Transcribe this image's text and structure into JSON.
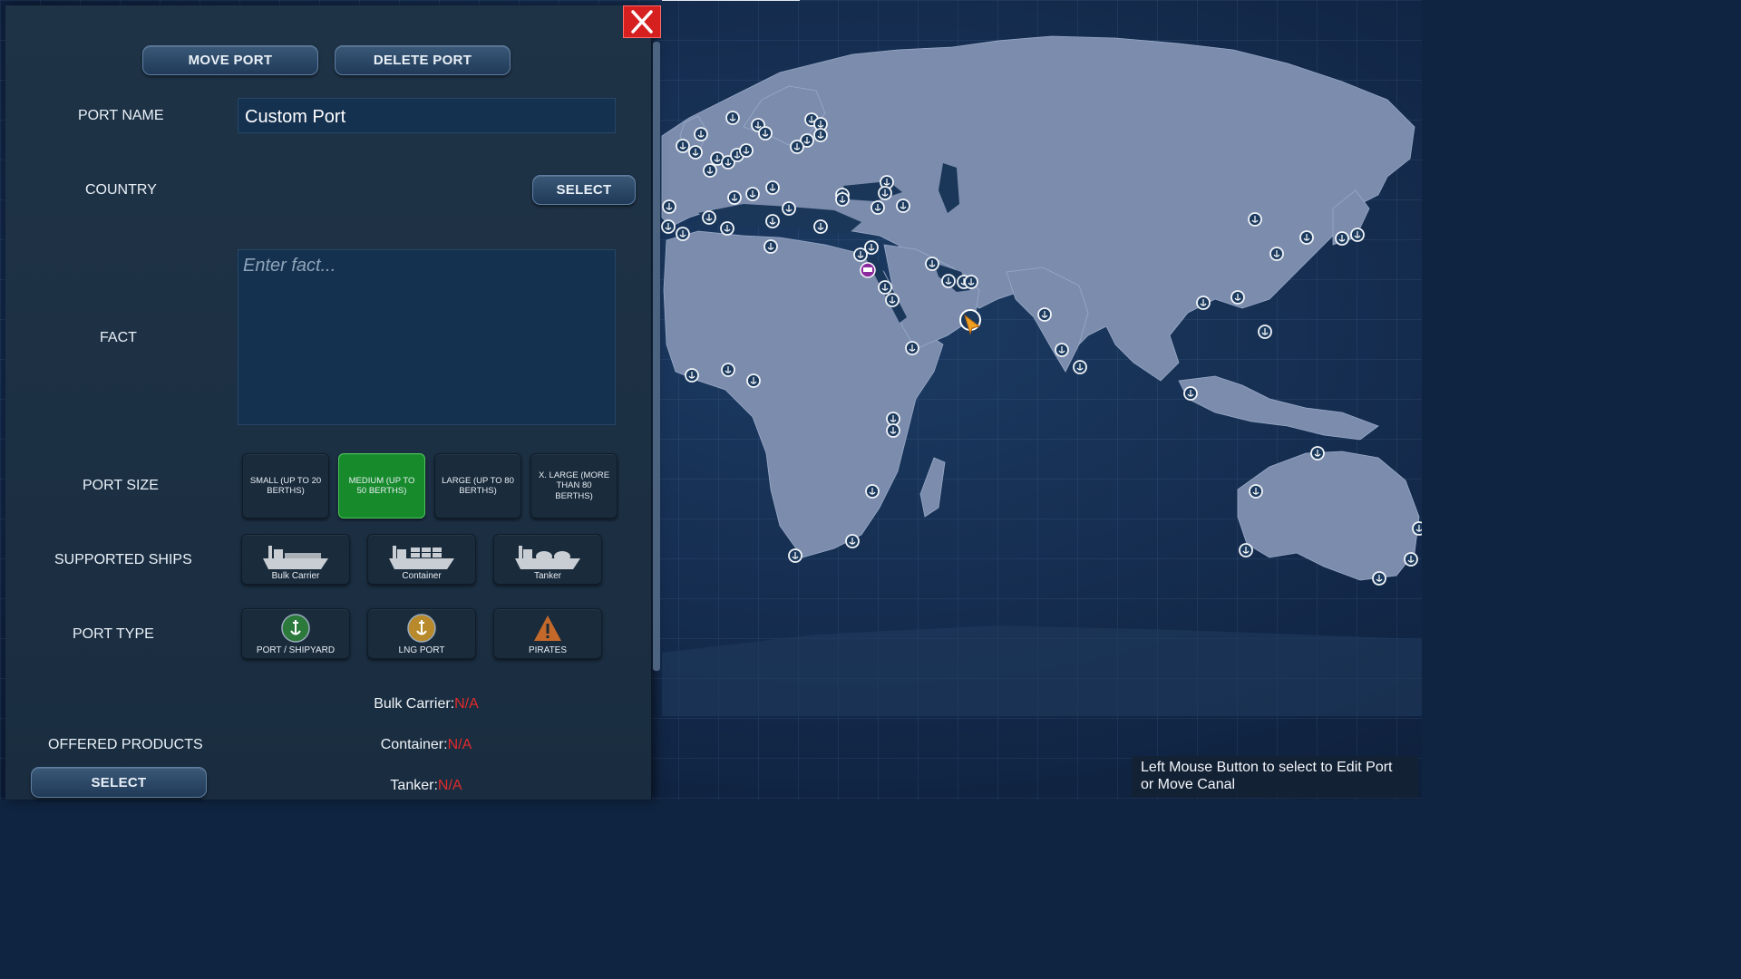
{
  "panel": {
    "move_port_label": "MOVE PORT",
    "delete_port_label": "DELETE PORT",
    "port_name_label": "PORT NAME",
    "port_name_value": "Custom Port",
    "country_label": "COUNTRY",
    "country_select_label": "SELECT",
    "fact_label": "FACT",
    "fact_placeholder": "Enter fact...",
    "port_size_label": "PORT SIZE",
    "port_sizes": [
      {
        "label": "SMALL (UP TO 20 BERTHS)",
        "selected": false
      },
      {
        "label": "MEDIUM (UP TO 50 BERTHS)",
        "selected": true
      },
      {
        "label": "LARGE (UP TO 80 BERTHS)",
        "selected": false
      },
      {
        "label": "X. LARGE (MORE THAN 80 BERTHS)",
        "selected": false
      }
    ],
    "supported_ships_label": "SUPPORTED SHIPS",
    "supported_ships": [
      {
        "label": "Bulk Carrier",
        "icon": "bulk-carrier-icon"
      },
      {
        "label": "Container",
        "icon": "container-ship-icon"
      },
      {
        "label": "Tanker",
        "icon": "tanker-icon"
      }
    ],
    "port_type_label": "PORT TYPE",
    "port_types": [
      {
        "label": "PORT / SHIPYARD",
        "icon": "anchor-green-icon"
      },
      {
        "label": "LNG PORT",
        "icon": "anchor-gold-icon"
      },
      {
        "label": "PIRATES",
        "icon": "warning-icon"
      }
    ],
    "offered_products_label": "OFFERED PRODUCTS",
    "offered_products_select_label": "SELECT",
    "products": [
      {
        "name": "Bulk Carrier:",
        "value": "N/A"
      },
      {
        "name": "Container:",
        "value": "N/A"
      },
      {
        "name": "Tanker:",
        "value": "N/A"
      }
    ]
  },
  "close_icon": "close-icon",
  "hint_text": "Left Mouse Button to select to Edit Port or Move Canal",
  "colors": {
    "accent_selected": "#178b2b",
    "na_red": "#e02b2b",
    "close_red": "#d62020",
    "land": "#7d8eaf",
    "ocean": "#13294a"
  }
}
